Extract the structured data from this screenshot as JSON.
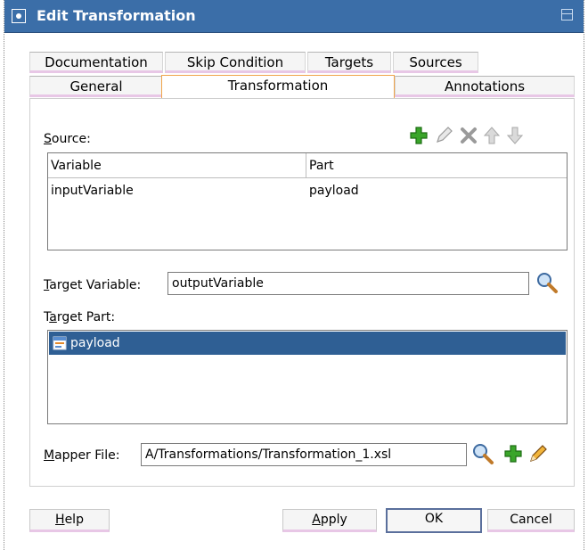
{
  "window": {
    "title": "Edit Transformation"
  },
  "tabs": {
    "row1": [
      "Documentation",
      "Skip Condition",
      "Targets",
      "Sources"
    ],
    "row2": [
      "General",
      "Transformation",
      "Annotations"
    ],
    "active": "Transformation"
  },
  "source": {
    "label": "Source:",
    "toolbar": [
      "add-icon",
      "edit-pencil-icon",
      "delete-x-icon",
      "move-up-icon",
      "move-down-icon"
    ],
    "columns": [
      "Variable",
      "Part"
    ],
    "rows": [
      {
        "variable": "inputVariable",
        "part": "payload"
      }
    ]
  },
  "target_variable": {
    "label": "Target Variable:",
    "value": "outputVariable"
  },
  "target_part": {
    "label": "Target Part:",
    "items": [
      "payload"
    ],
    "selected": "payload"
  },
  "mapper_file": {
    "label": "Mapper File:",
    "value": "A/Transformations/Transformation_1.xsl"
  },
  "buttons": {
    "help": "Help",
    "apply": "Apply",
    "ok": "OK",
    "cancel": "Cancel"
  },
  "colors": {
    "titlebar": "#3b6ea8",
    "selection": "#2f5f94",
    "active_tab_border": "#f0a44a"
  }
}
